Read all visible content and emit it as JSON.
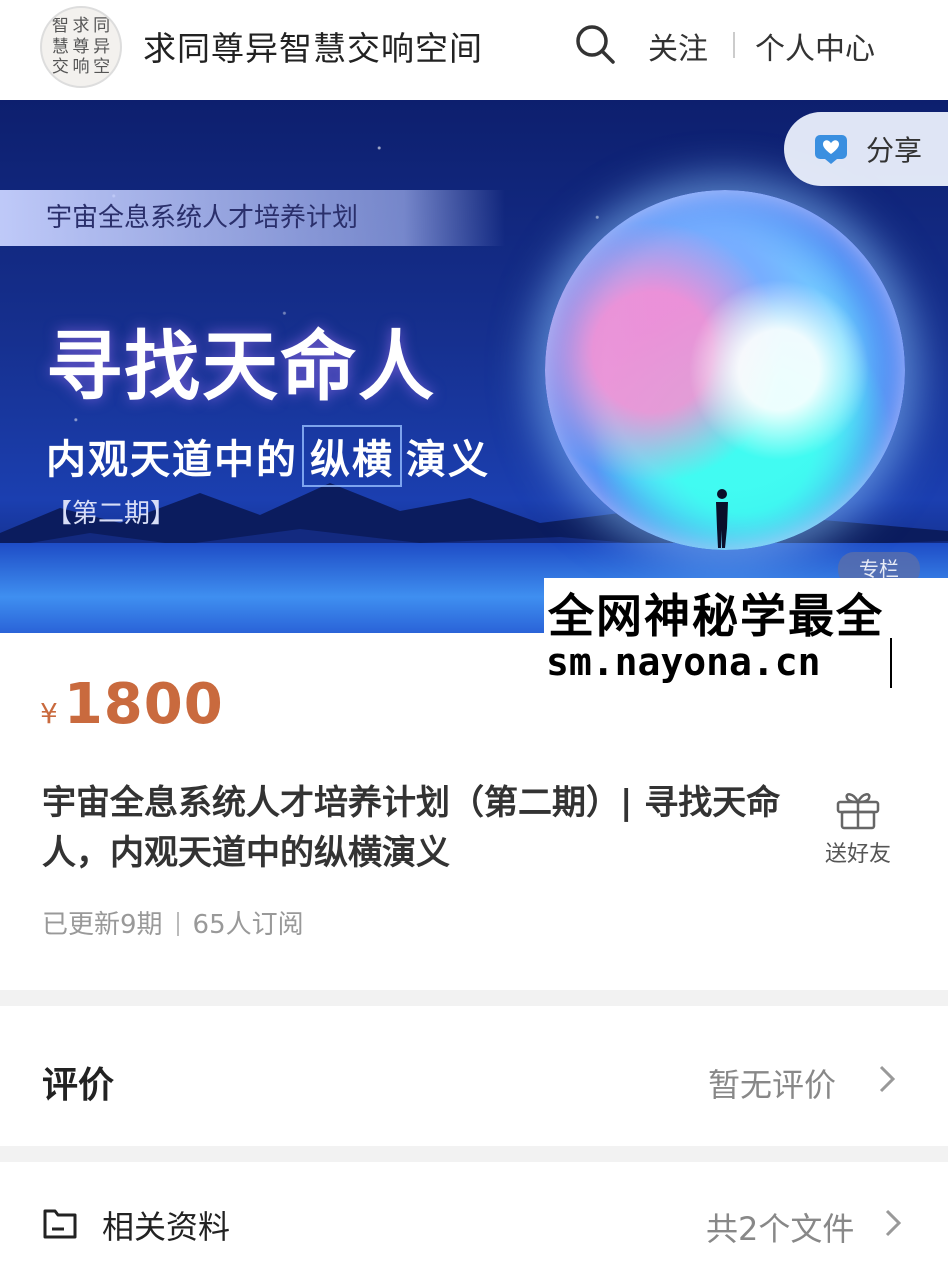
{
  "header": {
    "logo_chars": [
      "智",
      "求",
      "同",
      "慧",
      "尊",
      "异",
      "交",
      "响",
      "空"
    ],
    "site_title": "求同尊异智慧交响空间",
    "search_icon": "search-icon",
    "follow_label": "关注",
    "profile_label": "个人中心"
  },
  "banner": {
    "tag": "宇宙全息系统人才培养计划",
    "headline": "寻找天命人",
    "subtitle_prefix": "内观天道中的",
    "subtitle_box": "纵横",
    "subtitle_suffix": "演义",
    "issue": "【第二期】",
    "share_label": "分享",
    "share_icon": "heart-chat-icon",
    "column_badge": "专栏"
  },
  "watermark": {
    "line1": "全网神秘学最全",
    "line2": "sm.nayona.cn"
  },
  "product": {
    "currency": "¥",
    "price": "1800",
    "title": "宇宙全息系统人才培养计划（第二期）| 寻找天命人，内观天道中的纵横演义",
    "gift_label": "送好友",
    "gift_icon": "gift-icon",
    "updated": "已更新9期",
    "subscribers": "65人订阅"
  },
  "reviews": {
    "title": "评价",
    "value": "暂无评价"
  },
  "materials": {
    "title": "相关资料",
    "value": "共2个文件",
    "icon": "document-icon"
  },
  "colors": {
    "price": "#c96a3e",
    "banner_bg": "#16308f"
  }
}
